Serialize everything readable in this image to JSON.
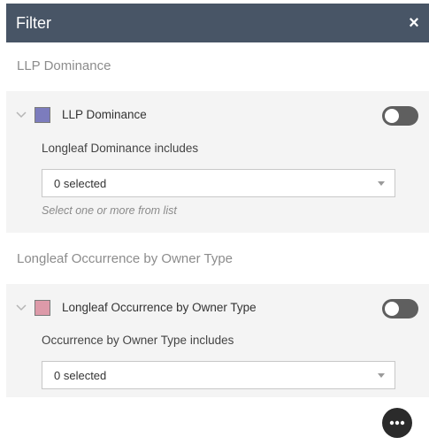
{
  "header": {
    "title": "Filter",
    "close_glyph": "×",
    "close_icon": "close-icon"
  },
  "filters": [
    {
      "section_title": "LLP Dominance",
      "layer_label": "LLP Dominance",
      "swatch_color": "#7c7cbd",
      "toggle_on": false,
      "includes_label": "Longleaf Dominance includes",
      "select_value": "0 selected",
      "hint": "Select one or more from list"
    },
    {
      "section_title": "Longleaf Occurrence by Owner Type",
      "layer_label": "Longleaf Occurrence by Owner Type",
      "swatch_color": "#dd9aa9",
      "toggle_on": false,
      "includes_label": "Occurrence by Owner Type includes",
      "select_value": "0 selected"
    }
  ],
  "footer": {
    "more_icon": "more-options-icon"
  },
  "colors": {
    "header_bg": "#485566",
    "group_bg": "#f4f4f4",
    "toggle_off": "#5f5f5f"
  }
}
